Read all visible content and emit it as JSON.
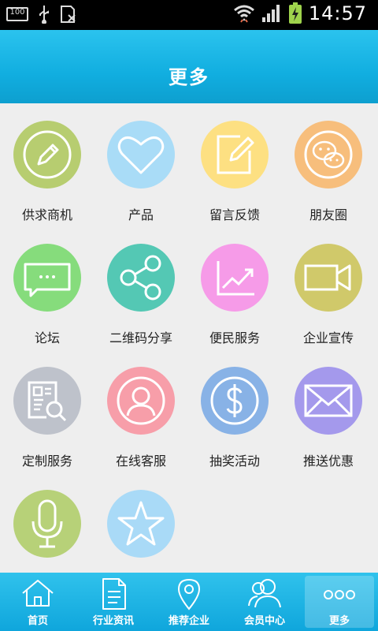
{
  "status_bar": {
    "time": "14:57",
    "battery_left": "100"
  },
  "header": {
    "title": "更多"
  },
  "grid": {
    "items": [
      {
        "label": "供求商机",
        "icon": "pencil-icon",
        "color": "#b7cd70"
      },
      {
        "label": "产品",
        "icon": "heart-icon",
        "color": "#a9dcf7"
      },
      {
        "label": "留言反馈",
        "icon": "edit-note-icon",
        "color": "#fde082"
      },
      {
        "label": "朋友圈",
        "icon": "chat-bubbles-icon",
        "color": "#f7be7c"
      },
      {
        "label": "论坛",
        "icon": "message-icon",
        "color": "#86dc7c"
      },
      {
        "label": "二维码分享",
        "icon": "share-icon",
        "color": "#54c8b4"
      },
      {
        "label": "便民服务",
        "icon": "chart-trend-icon",
        "color": "#f69be8"
      },
      {
        "label": "企业宣传",
        "icon": "video-camera-icon",
        "color": "#d0c96a"
      },
      {
        "label": "定制服务",
        "icon": "document-search-icon",
        "color": "#bec2cb"
      },
      {
        "label": "在线客服",
        "icon": "user-icon",
        "color": "#f79ea9"
      },
      {
        "label": "抽奖活动",
        "icon": "dollar-icon",
        "color": "#88b2e6"
      },
      {
        "label": "推送优惠",
        "icon": "envelope-icon",
        "color": "#a499ec"
      },
      {
        "label": "",
        "icon": "microphone-icon",
        "color": "#b7d178"
      },
      {
        "label": "",
        "icon": "star-icon",
        "color": "#a9daf7"
      }
    ]
  },
  "bottom_nav": {
    "items": [
      {
        "label": "首页",
        "icon": "home-icon"
      },
      {
        "label": "行业资讯",
        "icon": "document-icon"
      },
      {
        "label": "推荐企业",
        "icon": "location-pin-icon"
      },
      {
        "label": "会员中心",
        "icon": "members-icon"
      },
      {
        "label": "更多",
        "icon": "more-dots-icon",
        "active": true
      }
    ]
  }
}
